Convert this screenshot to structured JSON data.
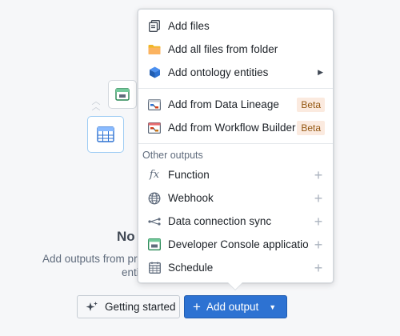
{
  "empty_state": {
    "title": "No outputs",
    "subtitle_line1": "Add outputs from project entities",
    "subtitle_line2": "entities"
  },
  "buttons": {
    "getting_started": "Getting started",
    "add_output": "Add output"
  },
  "menu": {
    "items": [
      {
        "label": "Add files",
        "icon": "files-icon"
      },
      {
        "label": "Add all files from folder",
        "icon": "folder-icon"
      },
      {
        "label": "Add ontology entities",
        "icon": "cube-icon"
      },
      {
        "label": "Add from Data Lineage",
        "icon": "data-lineage-icon",
        "badge": "Beta"
      },
      {
        "label": "Add from Workflow Builder",
        "icon": "workflow-builder-icon",
        "badge": "Beta"
      }
    ],
    "section_header": "Other outputs",
    "outputs": [
      {
        "label": "Function",
        "icon": "function-icon"
      },
      {
        "label": "Webhook",
        "icon": "globe-icon"
      },
      {
        "label": "Data connection sync",
        "icon": "data-connection-icon"
      },
      {
        "label": "Developer Console application",
        "icon": "developer-console-icon"
      },
      {
        "label": "Schedule",
        "icon": "calendar-icon"
      }
    ]
  },
  "colors": {
    "primary": "#2d72d2",
    "beta_bg": "#fbeadf",
    "beta_text": "#935610",
    "folder": "#f0b726"
  }
}
